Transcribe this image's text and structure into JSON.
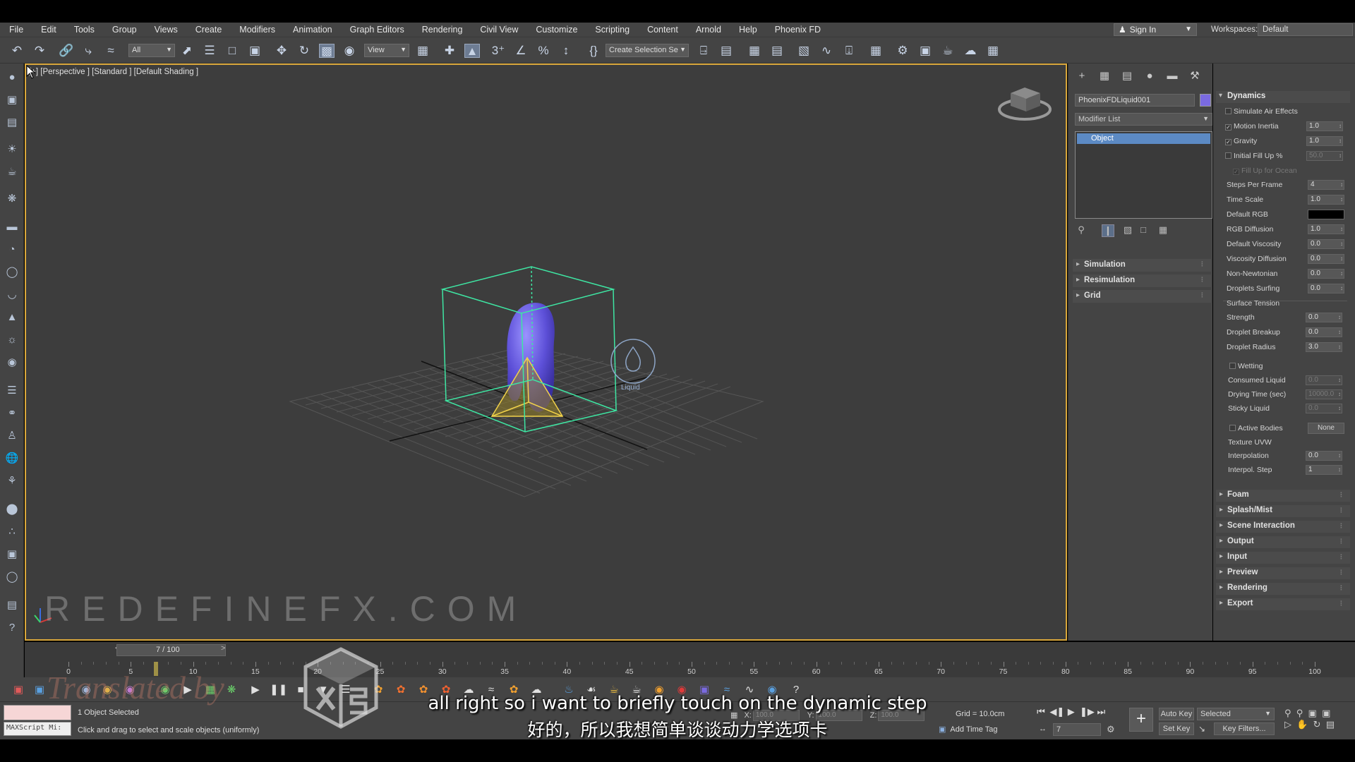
{
  "menu": [
    "File",
    "Edit",
    "Tools",
    "Group",
    "Views",
    "Create",
    "Modifiers",
    "Animation",
    "Graph Editors",
    "Rendering",
    "Civil View",
    "Customize",
    "Scripting",
    "Content",
    "Arnold",
    "Help",
    "Phoenix FD"
  ],
  "account": {
    "sign_in": "Sign In",
    "workspaces_label": "Workspaces:",
    "workspace": "Default"
  },
  "toolbar": {
    "filter": "All",
    "ref_coord": "View",
    "named_selection": "Create Selection Se"
  },
  "viewport": {
    "label": "[+] [Perspective ] [Standard ] [Default Shading ]",
    "helper_label": "Liquid",
    "watermark": "REDEFINEFX.COM"
  },
  "command_panel": {
    "object_name": "PhoenixFDLiquid001",
    "object_color": "#7a6ae0",
    "modifier_list": "Modifier List",
    "stack_item": "Object",
    "rollouts": [
      "Simulation",
      "Resimulation",
      "Grid"
    ]
  },
  "dynamics": {
    "title": "Dynamics",
    "params": [
      {
        "label": "Simulate Air Effects",
        "checkbox": true,
        "checked": false
      },
      {
        "label": "Motion Inertia",
        "checkbox": true,
        "checked": true,
        "value": "1.0"
      },
      {
        "label": "Gravity",
        "checkbox": true,
        "checked": true,
        "value": "1.0"
      },
      {
        "label": "Initial Fill Up %",
        "checkbox": true,
        "checked": false,
        "value": "50.0",
        "dim": true
      },
      {
        "label": "Fill Up for Ocean",
        "checkbox": true,
        "checked": true,
        "dim": true
      },
      {
        "label": "Steps Per Frame",
        "value": "4"
      },
      {
        "label": "Time Scale",
        "value": "1.0"
      },
      {
        "label": "Default RGB",
        "swatch": "#000000"
      },
      {
        "label": "RGB Diffusion",
        "value": "1.0"
      },
      {
        "label": "Default Viscosity",
        "value": "0.0"
      },
      {
        "label": "Viscosity Diffusion",
        "value": "0.0"
      },
      {
        "label": "Non-Newtonian",
        "value": "0.0"
      },
      {
        "label": "Droplets Surfing",
        "value": "0.0"
      }
    ],
    "surface_tension": {
      "title": "Surface Tension",
      "params": [
        {
          "label": "Strength",
          "value": "0.0"
        },
        {
          "label": "Droplet Breakup",
          "value": "0.0"
        },
        {
          "label": "Droplet Radius",
          "value": "3.0"
        }
      ]
    },
    "wetting": {
      "title": "Wetting",
      "params": [
        {
          "label": "Consumed Liquid",
          "value": "0.0"
        },
        {
          "label": "Drying Time (sec)",
          "value": "10000.0"
        },
        {
          "label": "Sticky Liquid",
          "value": "0.0"
        }
      ]
    },
    "active_bodies": {
      "label": "Active Bodies",
      "button": "None"
    },
    "texture_uvw": {
      "title": "Texture UVW",
      "params": [
        {
          "label": "Interpolation",
          "value": "0.0"
        },
        {
          "label": "Interpol. Step",
          "value": "1"
        }
      ]
    },
    "rollouts": [
      "Foam",
      "Splash/Mist",
      "Scene Interaction",
      "Output",
      "Input",
      "Preview",
      "Rendering",
      "Export"
    ]
  },
  "timeline": {
    "frame_display": "7 / 100",
    "ticks": [
      "0",
      "5",
      "10",
      "15",
      "20",
      "25",
      "30",
      "35",
      "40",
      "45",
      "50",
      "55",
      "60",
      "65",
      "70",
      "75",
      "80",
      "85",
      "90",
      "95",
      "100"
    ],
    "current_frame": 7
  },
  "status": {
    "maxscript": "MAXScript Mi:",
    "selection": "1 Object Selected",
    "prompt": "Click and drag to select and scale objects (uniformly)",
    "x_label": "X:",
    "x_value": "100.0",
    "y_label": "Y:",
    "y_value": "100.0",
    "z_label": "Z:",
    "z_value": "100.0",
    "grid": "Grid = 10.0cm",
    "add_time_tag": "Add Time Tag",
    "frame": "7",
    "auto_key": "Auto Key",
    "set_key": "Set Key",
    "selected": "Selected",
    "key_filters": "Key Filters..."
  },
  "overlay": {
    "subtitle_en": "all right so i want to briefly touch on the dynamic step",
    "subtitle_zh": "好的，所以我想简单谈谈动力学选项卡",
    "logo_text": "Translated by"
  }
}
